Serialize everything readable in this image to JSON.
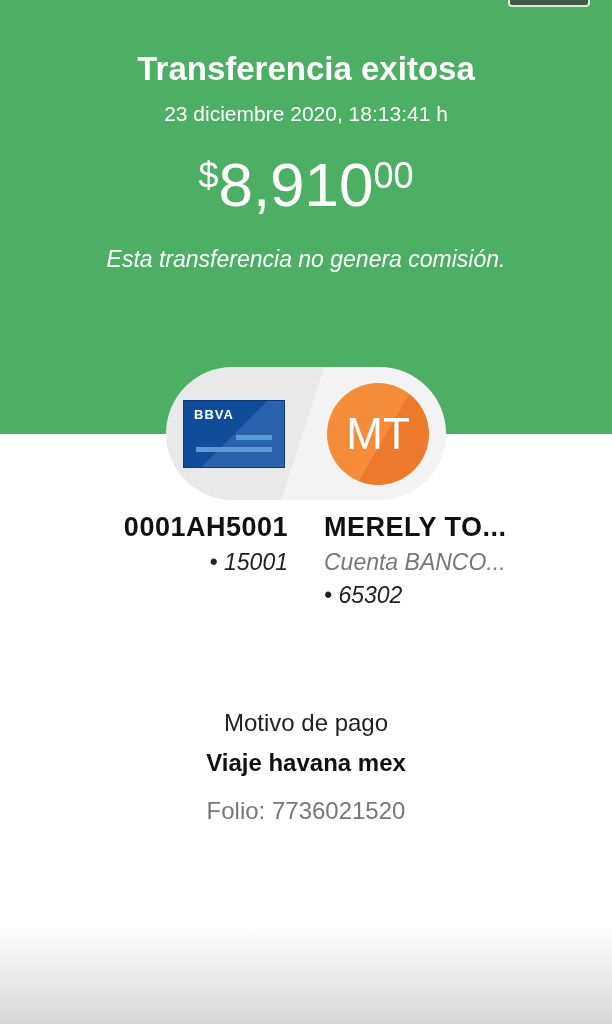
{
  "title": "Transferencia exitosa",
  "datetime": "23 diciembre 2020, 18:13:41 h",
  "amount": {
    "currency": "$",
    "whole": "8,910",
    "cents": "00"
  },
  "commission_note": "Esta transferencia no genera comisión.",
  "origin": {
    "bank_logo": "BBVA",
    "account": "0001AH5001",
    "lines": [
      "• 15001"
    ]
  },
  "destination": {
    "initials": "MT",
    "name": "MERELY TO...",
    "lines": [
      "Cuenta BANCO...",
      "• 65302"
    ]
  },
  "payment_reason": {
    "label": "Motivo de pago",
    "value": "Viaje havana mex"
  },
  "folio": "Folio: 7736021520"
}
